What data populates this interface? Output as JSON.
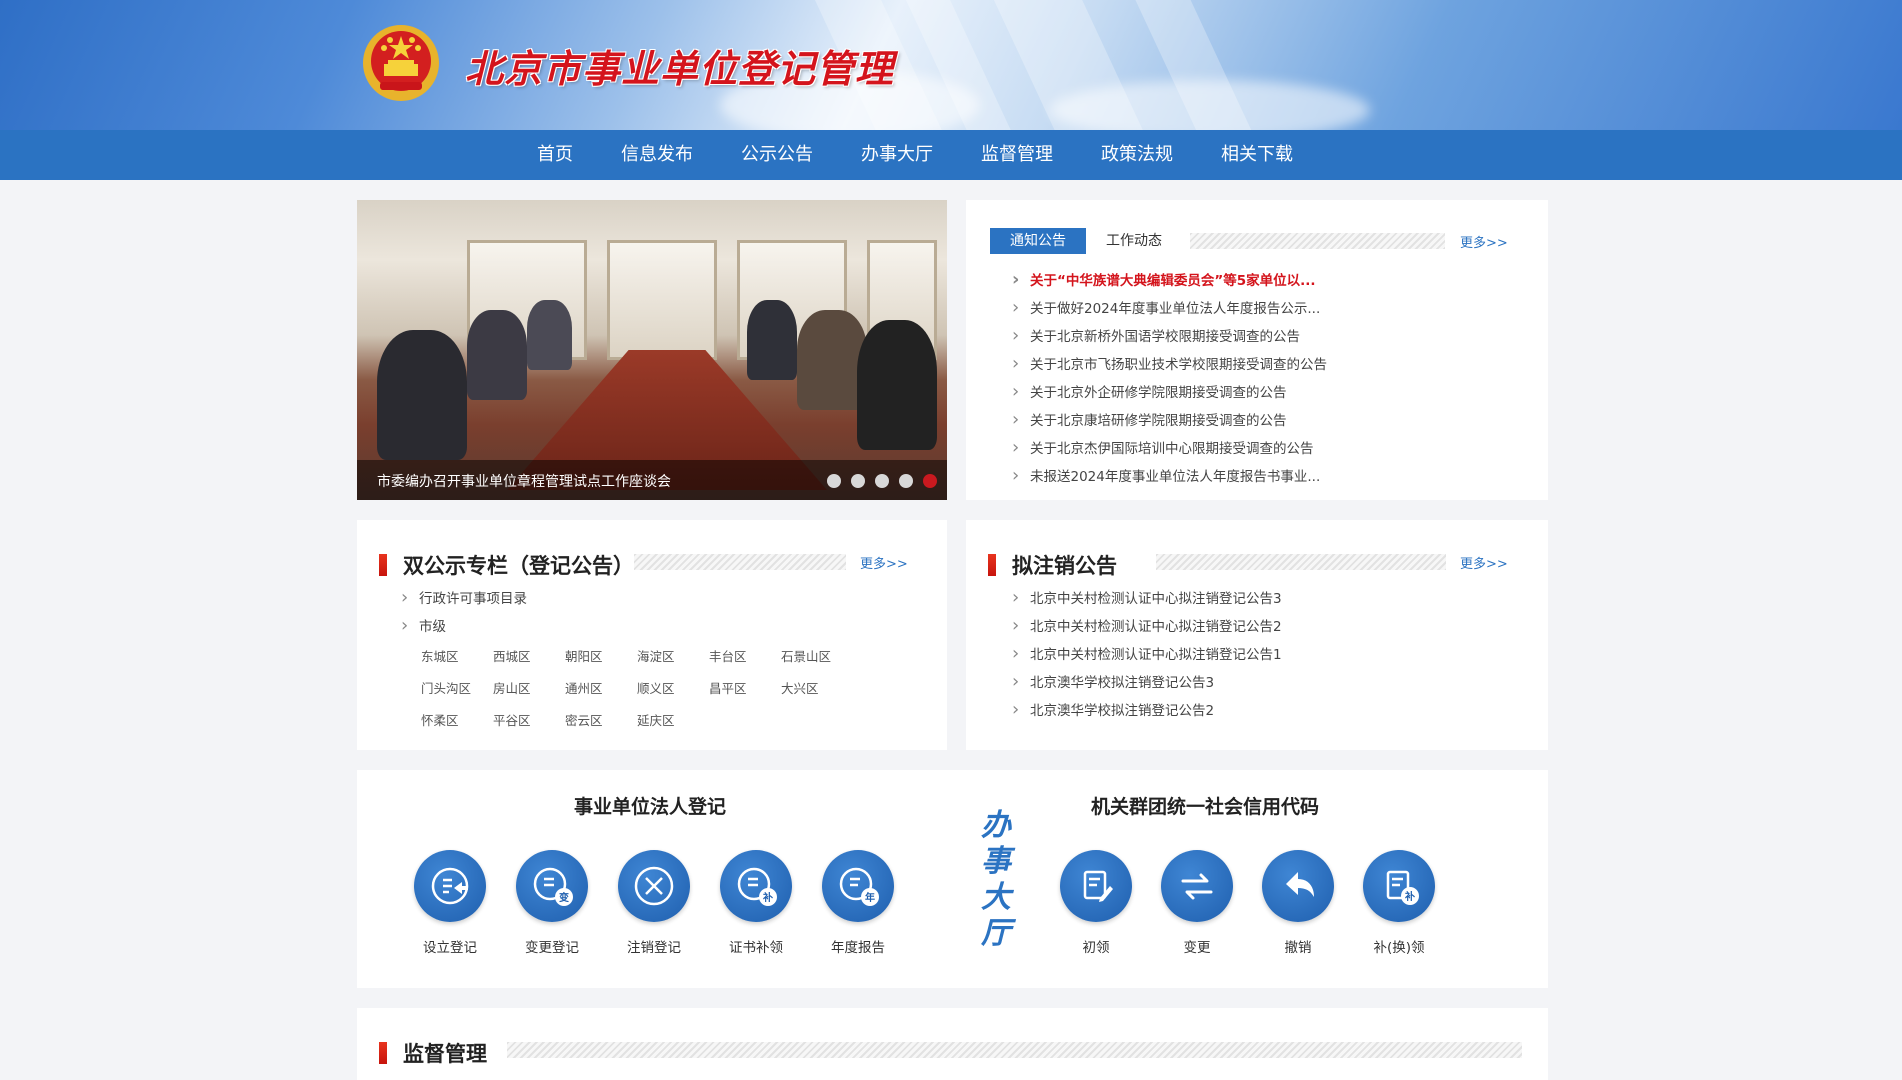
{
  "header": {
    "site_title": "北京市事业单位登记管理",
    "emblem_icon": "national-emblem-icon"
  },
  "nav": {
    "items": [
      "首页",
      "信息发布",
      "公示公告",
      "办事大厅",
      "监督管理",
      "政策法规",
      "相关下载"
    ]
  },
  "slider": {
    "caption": "市委编办召开事业单位章程管理试点工作座谈会",
    "slide_count": 5,
    "active_slide": 5
  },
  "notice": {
    "tabs": [
      "通知公告",
      "工作动态"
    ],
    "active_tab": "通知公告",
    "more": "更多>>",
    "items": [
      "关于“中华族谱大典编辑委员会”等5家单位以...",
      "关于做好2024年度事业单位法人年度报告公示...",
      "关于北京新桥外国语学校限期接受调查的公告",
      "关于北京市飞扬职业技术学校限期接受调查的公告",
      "关于北京外企研修学院限期接受调查的公告",
      "关于北京康培研修学院限期接受调查的公告",
      "关于北京杰伊国际培训中心限期接受调查的公告",
      "未报送2024年度事业单位法人年度报告书事业..."
    ]
  },
  "dual_publicity": {
    "title": "双公示专栏（登记公告）",
    "more": "更多>>",
    "items": [
      "行政许可事项目录",
      "市级"
    ],
    "districts": [
      "东城区",
      "西城区",
      "朝阳区",
      "海淀区",
      "丰台区",
      "石景山区",
      "门头沟区",
      "房山区",
      "通州区",
      "顺义区",
      "昌平区",
      "大兴区",
      "怀柔区",
      "平谷区",
      "密云区",
      "延庆区"
    ]
  },
  "cancellation": {
    "title": "拟注销公告",
    "more": "更多>>",
    "items": [
      "北京中关村检测认证中心拟注销登记公告3",
      "北京中关村检测认证中心拟注销登记公告2",
      "北京中关村检测认证中心拟注销登记公告1",
      "北京澳华学校拟注销登记公告3",
      "北京澳华学校拟注销登记公告2"
    ]
  },
  "services": {
    "legal_person_heading": "事业单位法人登记",
    "legal_person_items": [
      {
        "label": "设立登记",
        "icon": "establish-registration-icon"
      },
      {
        "label": "变更登记",
        "icon": "change-registration-icon"
      },
      {
        "label": "注销登记",
        "icon": "cancel-registration-icon"
      },
      {
        "label": "证书补领",
        "icon": "certificate-reissue-icon"
      },
      {
        "label": "年度报告",
        "icon": "annual-report-icon"
      }
    ],
    "hall_label": "办事大厅",
    "credit_code_heading": "机关群团统一社会信用代码",
    "credit_code_items": [
      {
        "label": "初领",
        "icon": "first-apply-icon"
      },
      {
        "label": "变更",
        "icon": "exchange-icon"
      },
      {
        "label": "撤销",
        "icon": "revoke-icon"
      },
      {
        "label": "补(换)领",
        "icon": "reissue-icon"
      }
    ]
  },
  "supervision": {
    "title": "监督管理"
  },
  "colors": {
    "brand_blue": "#2b73c2",
    "accent_red": "#d4141c",
    "page_bg": "#f3f4f7"
  }
}
